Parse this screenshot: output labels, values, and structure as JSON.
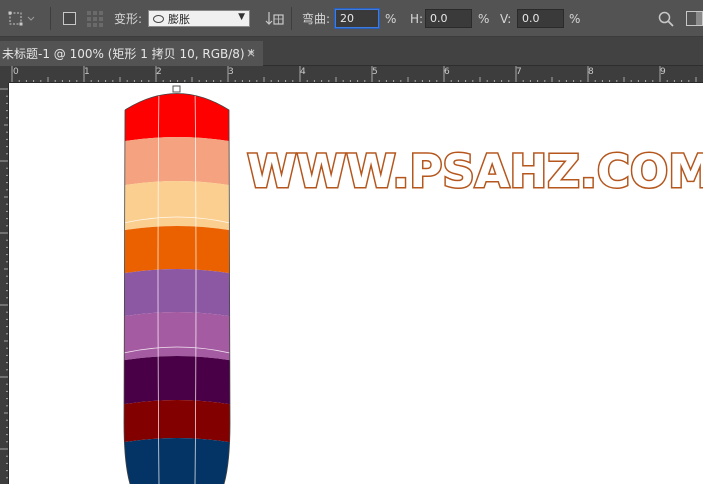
{
  "options_bar": {
    "transform_label": "变形:",
    "warp_style": "膨胀",
    "bend_label": "弯曲:",
    "bend_value": "20",
    "percent": "%",
    "h_label": "H:",
    "h_value": "0.0",
    "v_label": "V:",
    "v_value": "0.0"
  },
  "document_tab": {
    "title": "未标题-1 @ 100% (矩形 1 拷贝 10, RGB/8) *",
    "close": "×"
  },
  "ruler": {
    "labels": [
      "0",
      "1",
      "2",
      "3",
      "4",
      "5",
      "6",
      "7",
      "8",
      "9"
    ]
  },
  "canvas": {
    "watermark_text": "WWW.PSAHZ.COM",
    "watermark_color": "#b5561d",
    "stripes": [
      {
        "color": "#ff0000"
      },
      {
        "color": "#f4a27f"
      },
      {
        "color": "#fbcf8f"
      },
      {
        "color": "#eb6100"
      },
      {
        "color": "#8c58a3"
      },
      {
        "color": "#a55ba2"
      },
      {
        "color": "#4a0046"
      },
      {
        "color": "#820000"
      },
      {
        "color": "#033465"
      }
    ]
  }
}
